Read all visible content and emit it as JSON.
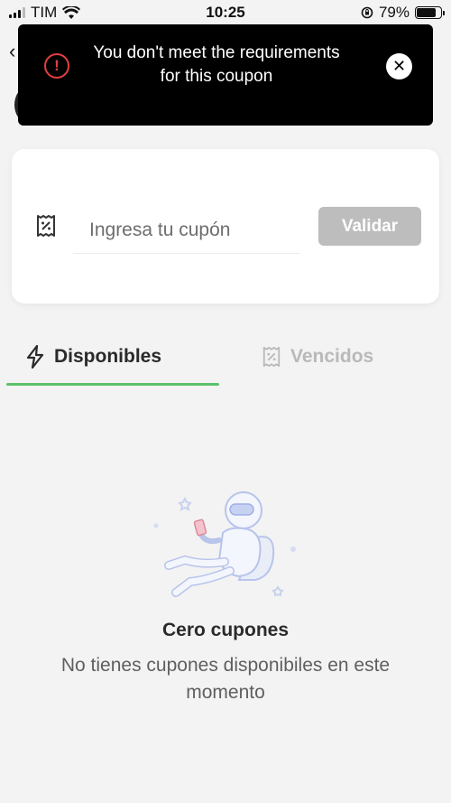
{
  "status_bar": {
    "carrier": "TIM",
    "time": "10:25",
    "battery_percent": "79%",
    "battery_level": 0.79
  },
  "toast": {
    "message": "You don't meet the requirements for this coupon",
    "alert_icon": "exclamation-circle-icon",
    "close_icon": "close-icon",
    "accent": "#e2403f",
    "background": "#000000"
  },
  "coupon_form": {
    "placeholder": "Ingresa tu cupón",
    "value": "",
    "validate_label": "Validar",
    "button_color": "#bdbdbd"
  },
  "tabs": [
    {
      "label": "Disponibles",
      "icon": "lightning-icon",
      "active": true
    },
    {
      "label": "Vencidos",
      "icon": "coupon-icon",
      "active": false
    }
  ],
  "tab_accent": "#5cc26a",
  "empty_state": {
    "title": "Cero cupones",
    "message": "No tienes cupones disponibiles en este momento",
    "illustration": "astronaut-illustration"
  }
}
